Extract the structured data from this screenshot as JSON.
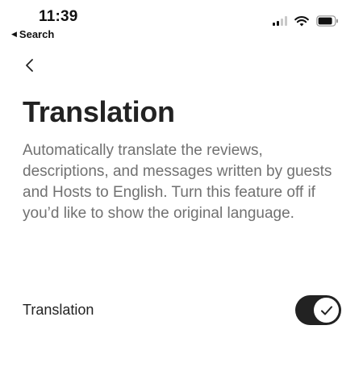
{
  "status_bar": {
    "time": "11:39",
    "back_app_label": "Search",
    "back_triangle_glyph": "◀",
    "signal_icon": "cellular-signal-icon",
    "wifi_icon": "wifi-icon",
    "battery_icon": "battery-icon"
  },
  "nav": {
    "back_icon": "chevron-left-icon"
  },
  "page": {
    "title": "Translation",
    "description": "Automatically translate the reviews, descriptions, and messages written by guests and Hosts to English. Turn this feature off if you’d like to show the original language."
  },
  "setting": {
    "label": "Translation",
    "enabled": true,
    "check_icon": "checkmark-icon"
  },
  "colors": {
    "text_primary": "#222222",
    "text_secondary": "#717171",
    "toggle_on": "#222222"
  }
}
